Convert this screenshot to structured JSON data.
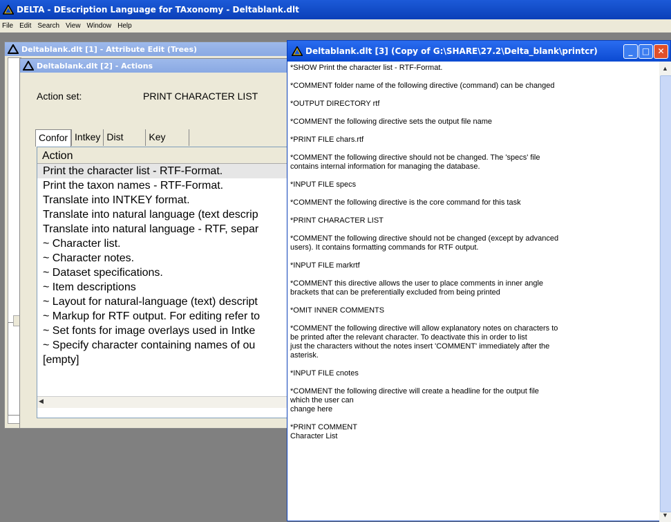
{
  "app": {
    "title": "DELTA - DEscription Language for TAxonomy - Deltablank.dlt",
    "menu": [
      "File",
      "Edit",
      "Search",
      "View",
      "Window",
      "Help"
    ]
  },
  "win1": {
    "title": "Deltablank.dlt [1] - Attribute Edit (Trees)"
  },
  "win2": {
    "title": "Deltablank.dlt [2] - Actions",
    "action_set_label": "Action set:",
    "action_set_value": "PRINT CHARACTER LIST",
    "tabs": [
      "Confor",
      "Intkey",
      "Dist",
      "Key"
    ],
    "list_header": "Action",
    "actions": [
      "Print the character list - RTF-Format.",
      "Print the taxon names - RTF-Format.",
      "Translate into INTKEY format.",
      "Translate into natural language (text descrip",
      "Translate into natural language - RTF, separ",
      "~ Character list.",
      "~ Character notes.",
      "~ Dataset specifications.",
      "~ Item descriptions",
      "~ Layout for natural-language (text) descript",
      "~ Markup for RTF output. For editing refer to",
      "~ Set fonts for image overlays used in Intke",
      "~ Specify character containing names of ou",
      "[empty]"
    ]
  },
  "win3": {
    "title": "Deltablank.dlt [3] (Copy of G:\\SHARE\\27.2\\Delta_blank\\printcr)",
    "lines": [
      "*SHOW Print the character list - RTF-Format.",
      "",
      "*COMMENT folder name of the following directive (command) can be changed",
      "",
      "*OUTPUT DIRECTORY rtf",
      "",
      "*COMMENT the following directive sets the output file name",
      "",
      "*PRINT FILE chars.rtf",
      "",
      "*COMMENT the following directive should not be changed. The 'specs' file",
      "contains internal information for managing the database.",
      "",
      "*INPUT FILE specs",
      "",
      "*COMMENT the following directive is the core command for this task",
      "",
      "*PRINT CHARACTER LIST",
      "",
      "*COMMENT the following directive should not be changed (except by advanced",
      "users). It contains formatting commands for RTF output.",
      "",
      "*INPUT FILE markrtf",
      "",
      "*COMMENT this directive allows the user to place comments in inner angle",
      "brackets that can be preferentially excluded from being printed",
      "",
      "*OMIT INNER COMMENTS",
      "",
      "*COMMENT the following directive will allow explanatory notes on characters to",
      "be printed after the relevant character. To deactivate this in order to list",
      "just the characters without the notes insert 'COMMENT' immediately after the",
      "asterisk.",
      "",
      "*INPUT FILE cnotes",
      "",
      "*COMMENT the following directive will create a headline for the output file",
      "which the user can",
      "change here",
      "",
      "*PRINT COMMENT",
      "Character List"
    ]
  }
}
